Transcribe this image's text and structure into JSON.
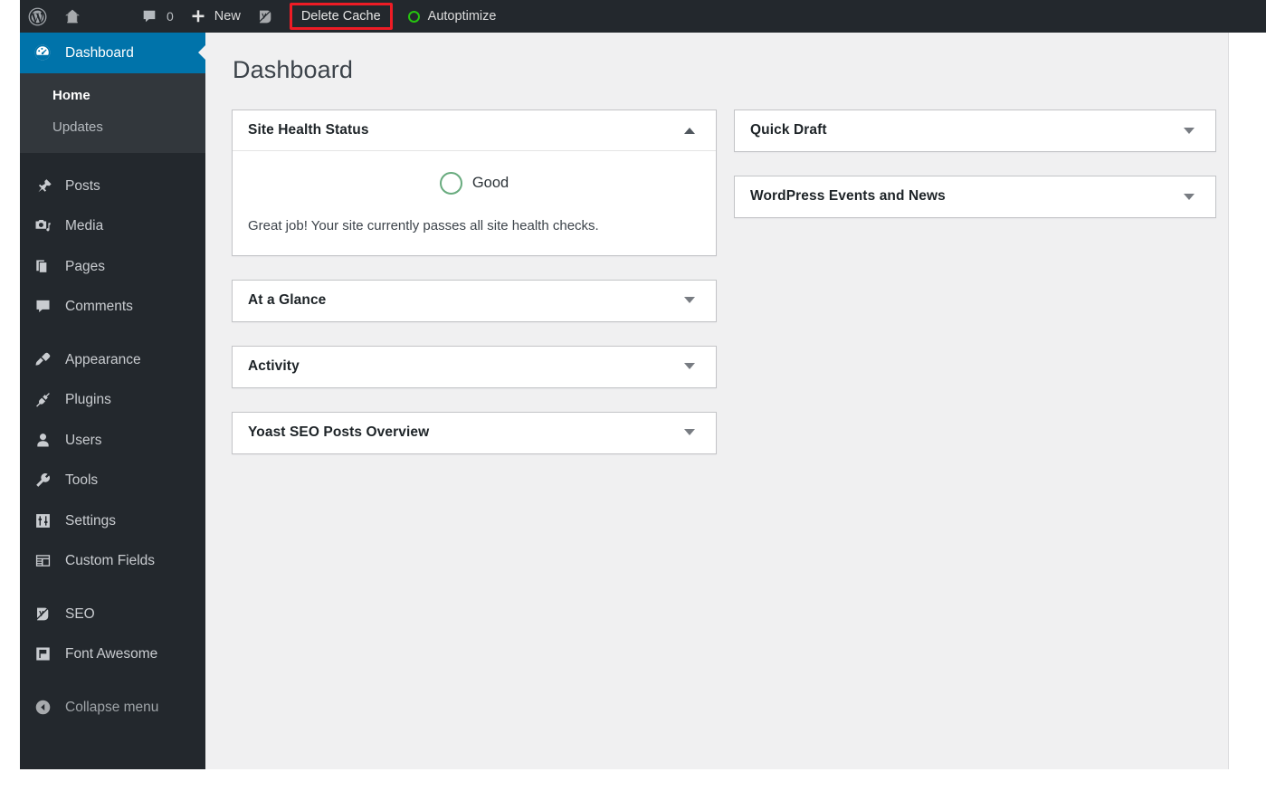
{
  "adminbar": {
    "wp_logo": "wordpress-logo-icon",
    "site_home": "home-icon",
    "comments_icon": "comment-bubble-icon",
    "comments_count": "0",
    "new_label": "New",
    "yoast_icon": "yoast-seo-icon",
    "delete_cache_label": "Delete Cache",
    "autoptimize_label": "Autoptimize",
    "highlight_color": "#ee1c25",
    "autoptimize_ring_color": "#26c40f",
    "background": "#23282d"
  },
  "sidebar": {
    "background": "#23282d",
    "active_background": "#0073aa",
    "submenu_background": "#32373c",
    "items": [
      {
        "label": "Dashboard",
        "icon": "dashboard-gauge-icon",
        "active": true
      },
      {
        "label": "Posts",
        "icon": "pin-icon"
      },
      {
        "label": "Media",
        "icon": "media-camera-music-icon"
      },
      {
        "label": "Pages",
        "icon": "pages-stack-icon"
      },
      {
        "label": "Comments",
        "icon": "comment-bubble-icon"
      },
      {
        "label": "Appearance",
        "icon": "paintbrush-icon"
      },
      {
        "label": "Plugins",
        "icon": "plug-icon"
      },
      {
        "label": "Users",
        "icon": "user-icon"
      },
      {
        "label": "Tools",
        "icon": "wrench-icon"
      },
      {
        "label": "Settings",
        "icon": "sliders-icon"
      },
      {
        "label": "Custom Fields",
        "icon": "table-grid-icon"
      },
      {
        "label": "SEO",
        "icon": "yoast-seo-icon"
      },
      {
        "label": "Font Awesome",
        "icon": "flag-icon"
      }
    ],
    "dashboard_submenu": [
      {
        "label": "Home",
        "current": true
      },
      {
        "label": "Updates",
        "current": false
      }
    ],
    "collapse": {
      "label": "Collapse menu",
      "icon": "collapse-arrow-left-icon"
    }
  },
  "main": {
    "page_title": "Dashboard",
    "background": "#f0f0f1",
    "left_column": [
      {
        "title": "Site Health Status",
        "state": "expanded",
        "toggle_icon": "chevron-up-icon",
        "health": {
          "status_label": "Good",
          "status_color": "#68ab7e",
          "status_icon": "circle-outline-icon",
          "description": "Great job! Your site currently passes all site health checks."
        }
      },
      {
        "title": "At a Glance",
        "state": "collapsed",
        "toggle_icon": "chevron-down-icon"
      },
      {
        "title": "Activity",
        "state": "collapsed",
        "toggle_icon": "chevron-down-icon"
      },
      {
        "title": "Yoast SEO Posts Overview",
        "state": "collapsed",
        "toggle_icon": "chevron-down-icon"
      }
    ],
    "right_column": [
      {
        "title": "Quick Draft",
        "state": "collapsed",
        "toggle_icon": "chevron-down-icon"
      },
      {
        "title": "WordPress Events and News",
        "state": "collapsed",
        "toggle_icon": "chevron-down-icon"
      }
    ]
  }
}
